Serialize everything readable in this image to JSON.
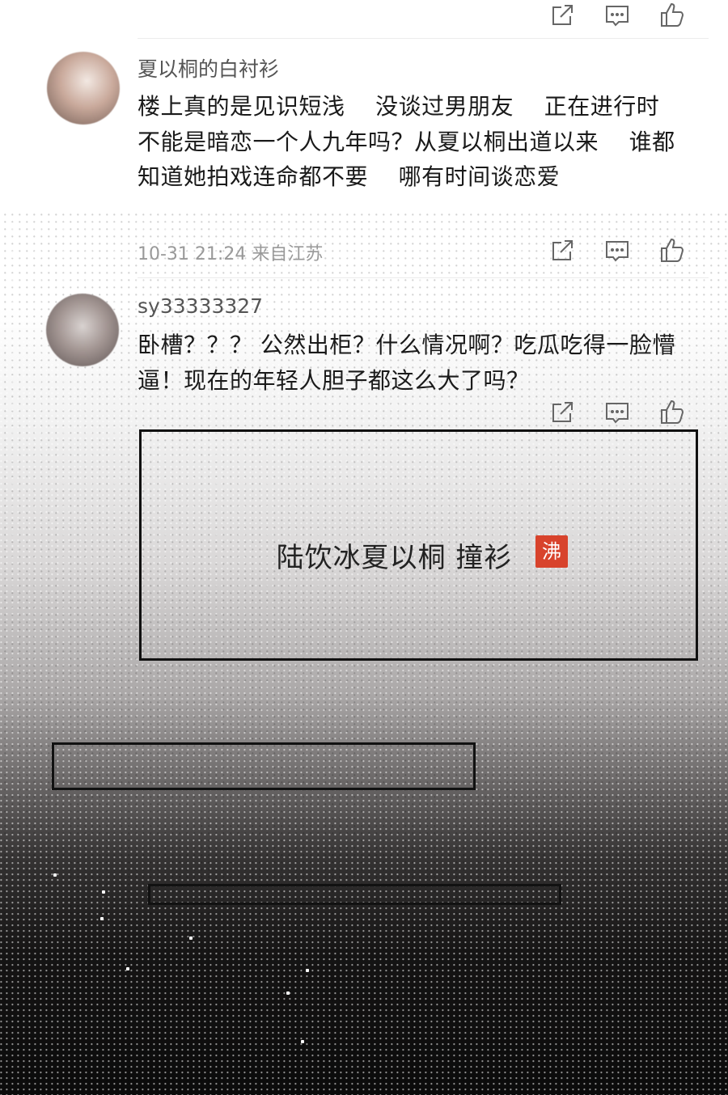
{
  "comments": [
    {
      "username": "夏以桐的白衬衫",
      "text": "楼上真的是见识短浅    没谈过男朋友    正在进行时    不能是暗恋一个人九年吗？从夏以桐出道以来    谁都知道她拍戏连命都不要    哪有时间谈恋爱",
      "meta": "10-31 21:24 来自江苏"
    },
    {
      "username": "sy33333327",
      "text": "卧槽？？？ 公然出柜？什么情况啊？吃瓜吃得一脸懵逼！现在的年轻人胆子都这么大了吗？"
    }
  ],
  "action_icons": [
    "share-icon",
    "comment-icon",
    "like-icon"
  ],
  "banner": {
    "title": "陆饮冰夏以桐 撞衫",
    "seal": "沸",
    "seal_color": "#d8432c"
  }
}
